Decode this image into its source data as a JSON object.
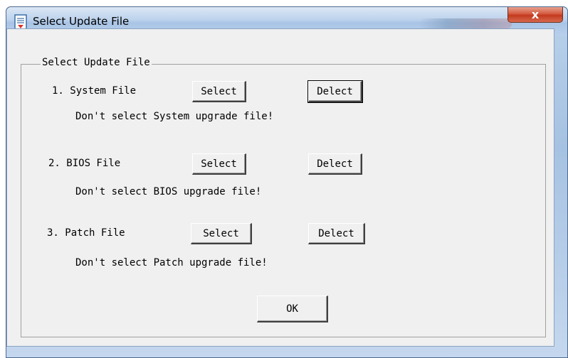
{
  "window": {
    "title": "Select Update File",
    "close_label": "x"
  },
  "group": {
    "legend": "Select Update File"
  },
  "items": [
    {
      "label": "1. System File",
      "select_label": "Select",
      "delect_label": "Delect",
      "status": "Don't select System upgrade file!"
    },
    {
      "label": "2. BIOS File",
      "select_label": "Select",
      "delect_label": "Delect",
      "status": "Don't select BIOS upgrade file!"
    },
    {
      "label": "3. Patch File",
      "select_label": "Select",
      "delect_label": "Delect",
      "status": "Don't select Patch upgrade file!"
    }
  ],
  "ok_label": "OK",
  "icons": {
    "title": "document-icon",
    "close": "close-icon"
  }
}
